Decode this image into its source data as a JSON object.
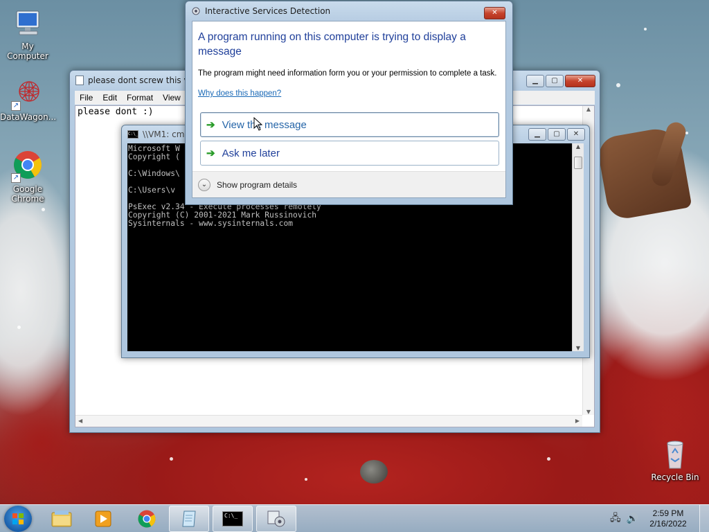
{
  "desktop": {
    "icons": [
      {
        "label": "My Computer",
        "icon": "computer-icon"
      },
      {
        "label": "DataWagon...",
        "icon": "datawagon-icon"
      },
      {
        "label": "Google Chrome",
        "icon": "chrome-icon"
      },
      {
        "label": "Recycle Bin",
        "icon": "recycle-bin-icon"
      }
    ]
  },
  "notepad": {
    "title": "please dont screw this vm",
    "menu": [
      "File",
      "Edit",
      "Format",
      "View"
    ],
    "text": "please dont :)"
  },
  "cmd": {
    "title": "\\\\VM1: cmd",
    "lines": [
      "Microsoft W",
      "Copyright (",
      "",
      "C:\\Windows\\",
      "",
      "C:\\Users\\v",
      "",
      "PsExec v2.34 - Execute processes remotely",
      "Copyright (C) 2001-2021 Mark Russinovich",
      "Sysinternals - www.sysinternals.com"
    ]
  },
  "dialog": {
    "title": "Interactive Services Detection",
    "heading": "A program running on this computer is trying to display a message",
    "body": "The program might need information form you or your permission to complete a task.",
    "link": "Why does this happen?",
    "option_view": "View the message",
    "option_later": "Ask me later",
    "details": "Show program details"
  },
  "taskbar": {
    "apps": [
      "explorer-icon",
      "media-player-icon",
      "chrome-icon",
      "notepad-icon",
      "cmd-icon",
      "services-icon"
    ],
    "time": "2:59 PM",
    "date": "2/16/2022"
  }
}
